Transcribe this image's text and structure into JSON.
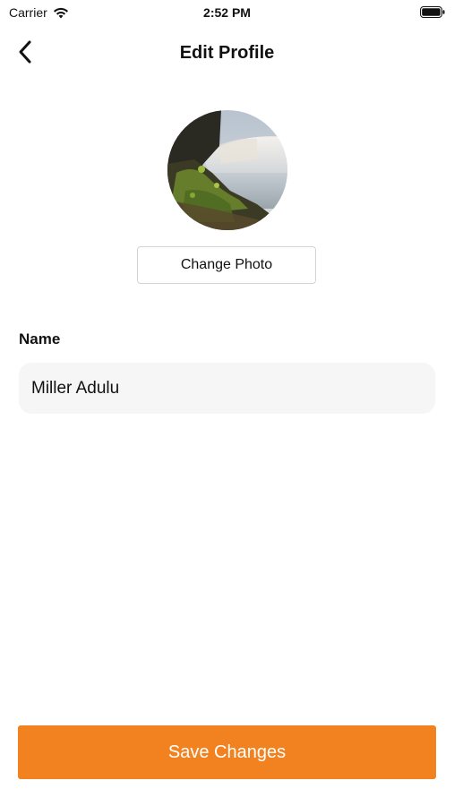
{
  "status_bar": {
    "carrier": "Carrier",
    "time": "2:52 PM"
  },
  "header": {
    "title": "Edit Profile",
    "back_icon": "chevron-left-icon"
  },
  "profile": {
    "avatar_description": "waterfall-photo",
    "change_photo_label": "Change Photo"
  },
  "form": {
    "name_label": "Name",
    "name_value": "Miller Adulu"
  },
  "actions": {
    "save_label": "Save Changes"
  },
  "colors": {
    "accent": "#f28220",
    "field_background": "#f6f6f6",
    "text": "#111111"
  }
}
